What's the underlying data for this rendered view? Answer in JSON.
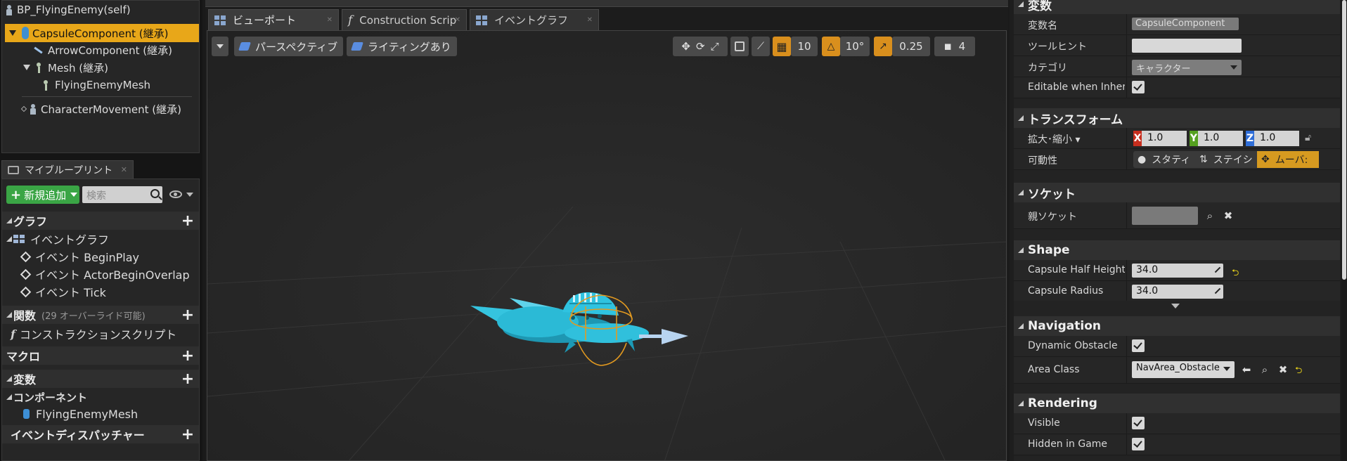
{
  "components": {
    "root": "BP_FlyingEnemy(self)",
    "items": [
      {
        "label": "CapsuleComponent (継承)"
      },
      {
        "label": "ArrowComponent (継承)"
      },
      {
        "label": "Mesh (継承)"
      },
      {
        "label": "FlyingEnemyMesh"
      },
      {
        "label": "CharacterMovement (継承)"
      }
    ]
  },
  "my_blueprint": {
    "tab_label": "マイブループリント",
    "add_new_label": "新規追加",
    "search_placeholder": "検索",
    "sections": {
      "graph": "グラフ",
      "functions": "関数",
      "functions_note": "(29 オーバーライド可能)",
      "macros": "マクロ",
      "variables": "変数",
      "components": "コンポーネント",
      "dispatchers": "イベントディスパッチャー"
    },
    "event_graph": "イベントグラフ",
    "events": [
      "イベント BeginPlay",
      "イベント ActorBeginOverlap",
      "イベント Tick"
    ],
    "construction_script": "コンストラクションスクリプト",
    "component_item": "FlyingEnemyMesh"
  },
  "editor_tabs": [
    {
      "label": "ビューポート"
    },
    {
      "label": "Construction Scrip"
    },
    {
      "label": "イベントグラフ"
    }
  ],
  "viewport": {
    "perspective_label": "パースペクティブ",
    "lighting_label": "ライティングあり",
    "grid_snap": "10",
    "rotation_snap": "10°",
    "scale_snap": "0.25",
    "camera_speed": "4"
  },
  "details": {
    "variable": {
      "header": "変数",
      "name_label": "変数名",
      "name_value": "CapsuleComponent",
      "tooltip_label": "ツールヒント",
      "tooltip_value": "",
      "category_label": "カテゴリ",
      "category_value": "キャラクター",
      "editable_label": "Editable when Inherit",
      "editable_checked": true
    },
    "transform": {
      "header": "トランスフォーム",
      "scale_label": "拡大･縮小",
      "scale": {
        "x": "1.0",
        "y": "1.0",
        "z": "1.0"
      },
      "mobility_label": "可動性",
      "mobility_options": [
        "スタティ",
        "ステイシ",
        "ムーバ:"
      ],
      "mobility_selected": "ムーバ:"
    },
    "socket": {
      "header": "ソケット",
      "parent_label": "親ソケット"
    },
    "shape": {
      "header": "Shape",
      "half_height_label": "Capsule Half Height",
      "half_height_value": "34.0",
      "radius_label": "Capsule Radius",
      "radius_value": "34.0"
    },
    "navigation": {
      "header": "Navigation",
      "dynamic_label": "Dynamic Obstacle",
      "dynamic_checked": true,
      "area_label": "Area Class",
      "area_value": "NavArea_Obstacle"
    },
    "rendering": {
      "header": "Rendering",
      "visible_label": "Visible",
      "hidden_label": "Hidden in Game"
    }
  },
  "colors": {
    "selection": "#e8a719",
    "add_button": "#3aa545",
    "ship": "#2fc3e0",
    "collision": "#e39a20"
  }
}
